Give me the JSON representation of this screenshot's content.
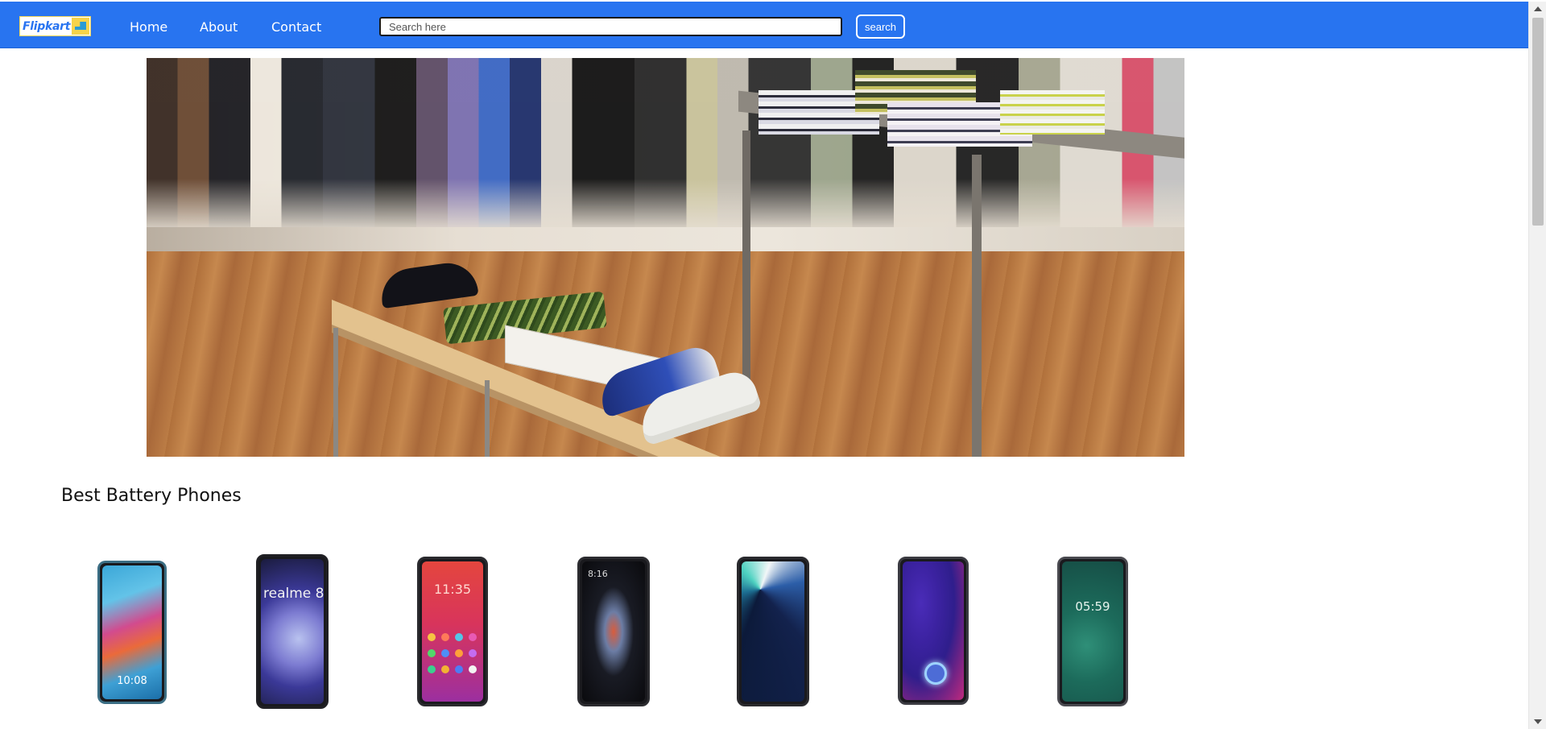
{
  "nav": {
    "logo_text": "Flipkart",
    "links": [
      "Home",
      "About",
      "Contact"
    ],
    "search": {
      "placeholder": "Search here",
      "value": "",
      "button_label": "search"
    },
    "bar_color": "#2874f0"
  },
  "hero": {
    "icon": "clothing-store-photo"
  },
  "section": {
    "title": "Best Battery Phones"
  },
  "phones": [
    {
      "icon": "phone-product-image",
      "screen_text": "10:08"
    },
    {
      "icon": "phone-product-image",
      "screen_text": "realme 8"
    },
    {
      "icon": "phone-product-image",
      "screen_text": "11:35"
    },
    {
      "icon": "phone-product-image",
      "screen_text": "8:16"
    },
    {
      "icon": "phone-product-image",
      "screen_text": ""
    },
    {
      "icon": "phone-product-image",
      "screen_text": ""
    },
    {
      "icon": "phone-product-image",
      "screen_text": "05:59"
    }
  ]
}
